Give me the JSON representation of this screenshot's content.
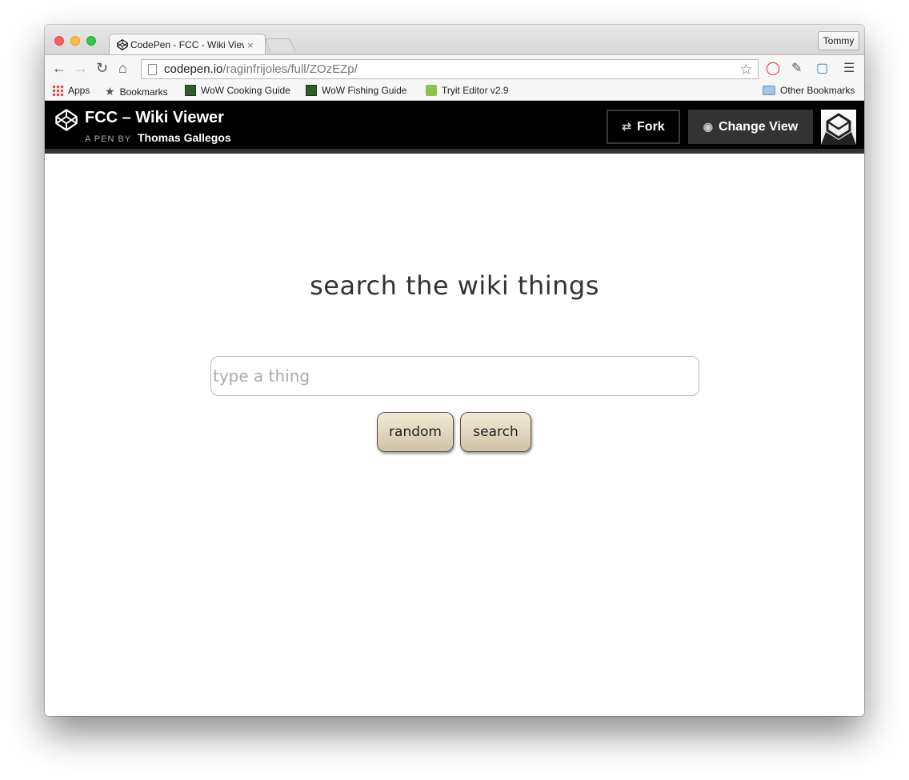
{
  "browser": {
    "tab_title": "CodePen - FCC - Wiki Viewer",
    "tab_close": "×",
    "profile": "Tommy",
    "url_host": "codepen.io",
    "url_path": "/raginfrijoles/full/ZOzEZp/"
  },
  "bookmarks": {
    "items": [
      {
        "label": "Apps",
        "icon": "apps-grid-icon"
      },
      {
        "label": "Bookmarks",
        "icon": "star-icon"
      },
      {
        "label": "WoW Cooking Guide",
        "icon": "wow-icon"
      },
      {
        "label": "WoW Fishing Guide",
        "icon": "wow-icon"
      },
      {
        "label": "Tryit Editor v2.9",
        "icon": "tryit-icon"
      }
    ],
    "other": "Other Bookmarks"
  },
  "codepen": {
    "title": "FCC – Wiki Viewer",
    "by_prefix": "A PEN BY",
    "author": "Thomas Gallegos",
    "fork_label": "Fork",
    "change_view_label": "Change View"
  },
  "page": {
    "heading": "search the wiki things",
    "search_placeholder": "type a thing",
    "random_label": "random",
    "search_label": "search"
  },
  "colors": {
    "header_bg": "#000000",
    "button_gradient_top": "#f2ead4",
    "button_gradient_bottom": "#cfc3a3"
  }
}
